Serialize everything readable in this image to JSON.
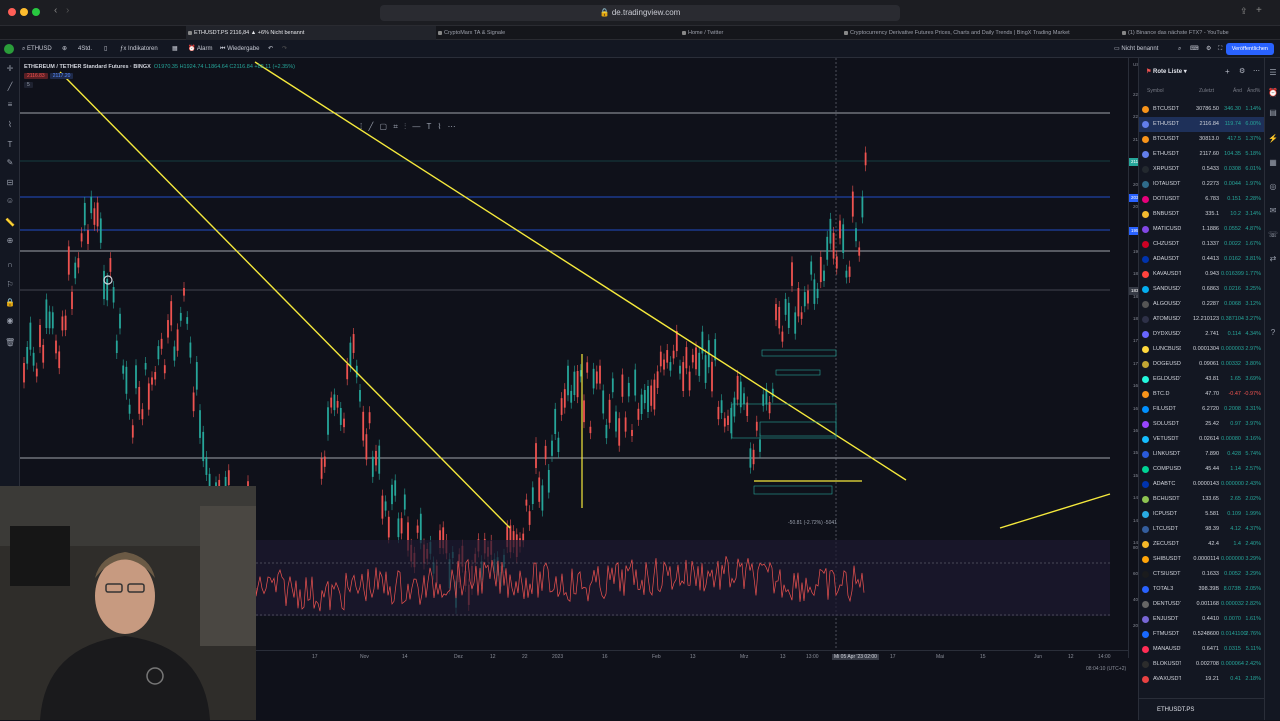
{
  "browser": {
    "url": "de.tradingview.com",
    "tabs": [
      {
        "label": "ETHUSDT.PS 2116,84 ▲ +6% Nicht benannt",
        "active": true
      },
      {
        "label": "CryptoMarx TA & Signale",
        "active": false
      },
      {
        "label": "Home / Twitter",
        "active": false
      },
      {
        "label": "Cryptocurrency Derivative Futures Prices, Charts and Daily Trends | BingX Trading Market",
        "active": false
      },
      {
        "label": "(1) Binance das nächste FTX? - YouTube",
        "active": false
      }
    ]
  },
  "toolbar": {
    "symbol": "ETHUSD",
    "interval": "4Std.",
    "indicators": "Indikatoren",
    "alarm": "Alarm",
    "replay": "Wiedergabe",
    "layout_name": "Nicht benannt",
    "layout_sub": "Speichern",
    "publish": "Veröffentlichen"
  },
  "legend": {
    "title": "ETHEREUM / TETHER Standard Futures · BINGX",
    "ohlc": "O1970.35 H1924.74 L1864.64 C2116.84 +82.11 (+2.35%)",
    "bid": "2116.83",
    "ask": "2117.20",
    "spread": "5"
  },
  "price_axis": {
    "currency": "USDT",
    "ticks": [
      "2250.00",
      "2200.00",
      "2150.00",
      "2100.00",
      "2060.00",
      "2010.00",
      "1960.00",
      "1920.00",
      "1880.00",
      "1850.00",
      "1810.00",
      "1770.00",
      "1730.00",
      "1690.00",
      "1650.00",
      "1610.00",
      "1570.00",
      "1530.00",
      "1490.00",
      "1450.00",
      "1410.00"
    ],
    "rsi_ticks": [
      "80.00",
      "60.00",
      "40.00",
      "20.00"
    ],
    "price_label": "ETHUSDT.PS",
    "price_value": "2116.84",
    "price_sub": "01:57:02",
    "level_a": "2031.89",
    "level_b": "1957.23",
    "crosshair_value": "1831.89"
  },
  "time_axis": {
    "ticks": [
      "17",
      "Nov",
      "14",
      "Dez",
      "12",
      "22",
      "2023",
      "16",
      "Feb",
      "13",
      "Mrz",
      "13",
      "13:00",
      "Mi 05 Apr '23  02:00",
      "17",
      "Mai",
      "15",
      "Jun",
      "12",
      "14:00"
    ],
    "timezone": "08:04:10 (UTC+2)",
    "scale": "auto"
  },
  "measure": {
    "label": "-50.81 (-2.72%) -5041"
  },
  "watchlist": {
    "title": "Rote Liste",
    "columns": {
      "symbol": "Symbol",
      "last": "Zuletzt",
      "chg": "Änd",
      "chg_pct": "Änd%"
    },
    "rows": [
      {
        "symbol": "BTCUSDT",
        "last": "30786.50",
        "chg": "346.30",
        "pct": "1.14%",
        "color": "#f7931a",
        "sel": false
      },
      {
        "symbol": "ETHUSDT",
        "last": "2116.84",
        "chg": "119.74",
        "pct": "6.00%",
        "color": "#627eea",
        "sel": true
      },
      {
        "symbol": "BTCUSDT",
        "last": "30813.0",
        "chg": "417.5",
        "pct": "1.37%",
        "color": "#f7931a",
        "sel": false
      },
      {
        "symbol": "ETHUSDT",
        "last": "2117.60",
        "chg": "104.35",
        "pct": "5.18%",
        "color": "#627eea",
        "sel": false
      },
      {
        "symbol": "XRPUSDT",
        "last": "0.5433",
        "chg": "0.0308",
        "pct": "6.01%",
        "color": "#23292f",
        "sel": false
      },
      {
        "symbol": "IOTAUSDT",
        "last": "0.2273",
        "chg": "0.0044",
        "pct": "1.97%",
        "color": "#2f6b8a",
        "sel": false
      },
      {
        "symbol": "DOTUSDT",
        "last": "6.783",
        "chg": "0.151",
        "pct": "2.28%",
        "color": "#e6007a",
        "sel": false
      },
      {
        "symbol": "BNBUSDT",
        "last": "335.1",
        "chg": "10.2",
        "pct": "3.14%",
        "color": "#f3ba2f",
        "sel": false
      },
      {
        "symbol": "MATICUSDT",
        "last": "1.1886",
        "chg": "0.0552",
        "pct": "4.87%",
        "color": "#8247e5",
        "sel": false
      },
      {
        "symbol": "CHZUSDT",
        "last": "0.1337",
        "chg": "0.0022",
        "pct": "1.67%",
        "color": "#cd0124",
        "sel": false
      },
      {
        "symbol": "ADAUSDT",
        "last": "0.4413",
        "chg": "0.0162",
        "pct": "3.81%",
        "color": "#0033ad",
        "sel": false
      },
      {
        "symbol": "KAVAUSDT",
        "last": "0.943",
        "chg": "0.016399",
        "pct": "1.77%",
        "color": "#ff433e",
        "sel": false
      },
      {
        "symbol": "SANDUSDT",
        "last": "0.6863",
        "chg": "0.0216",
        "pct": "3.25%",
        "color": "#04adef",
        "sel": false
      },
      {
        "symbol": "ALGOUSDT",
        "last": "0.2287",
        "chg": "0.0068",
        "pct": "3.12%",
        "color": "#555555",
        "sel": false
      },
      {
        "symbol": "ATOMUSDT",
        "last": "12.210123",
        "chg": "0.387104",
        "pct": "3.27%",
        "color": "#2e3148",
        "sel": false
      },
      {
        "symbol": "DYDXUSDT",
        "last": "2.741",
        "chg": "0.114",
        "pct": "4.34%",
        "color": "#6966ff",
        "sel": false
      },
      {
        "symbol": "LUNCBUSD",
        "last": "0.0001304",
        "chg": "0.000003",
        "pct": "2.97%",
        "color": "#ffd83d",
        "sel": false
      },
      {
        "symbol": "DOGEUSDT",
        "last": "0.09061",
        "chg": "0.00332",
        "pct": "3.80%",
        "color": "#c2a633",
        "sel": false
      },
      {
        "symbol": "EGLDUSDT",
        "last": "43.81",
        "chg": "1.65",
        "pct": "3.69%",
        "color": "#23f7dd",
        "sel": false
      },
      {
        "symbol": "BTC.D",
        "last": "47.70",
        "chg": "-0.47",
        "pct": "-0.97%",
        "color": "#f7931a",
        "sel": false
      },
      {
        "symbol": "FILUSDT",
        "last": "6.2720",
        "chg": "0.2008",
        "pct": "3.31%",
        "color": "#0090ff",
        "sel": false
      },
      {
        "symbol": "SOLUSDT",
        "last": "25.42",
        "chg": "0.97",
        "pct": "3.97%",
        "color": "#9945ff",
        "sel": false
      },
      {
        "symbol": "VETUSDT",
        "last": "0.02614",
        "chg": "0.00080",
        "pct": "3.16%",
        "color": "#15bdff",
        "sel": false
      },
      {
        "symbol": "LINKUSDT",
        "last": "7.890",
        "chg": "0.428",
        "pct": "5.74%",
        "color": "#2a5ada",
        "sel": false
      },
      {
        "symbol": "COMPUSDT",
        "last": "45.44",
        "chg": "1.14",
        "pct": "2.57%",
        "color": "#00d395",
        "sel": false
      },
      {
        "symbol": "ADABTC",
        "last": "0.0000143",
        "chg": "0.000000",
        "pct": "2.43%",
        "color": "#0033ad",
        "sel": false
      },
      {
        "symbol": "BCHUSDT",
        "last": "133.65",
        "chg": "2.65",
        "pct": "2.02%",
        "color": "#8dc351",
        "sel": false
      },
      {
        "symbol": "ICPUSDT",
        "last": "5.581",
        "chg": "0.109",
        "pct": "1.99%",
        "color": "#29abe2",
        "sel": false
      },
      {
        "symbol": "LTCUSDT",
        "last": "98.39",
        "chg": "4.12",
        "pct": "4.37%",
        "color": "#345d9d",
        "sel": false
      },
      {
        "symbol": "ZECUSDT",
        "last": "42.4",
        "chg": "1.4",
        "pct": "2.40%",
        "color": "#f4b728",
        "sel": false
      },
      {
        "symbol": "SHIBUSDT",
        "last": "0.0000114",
        "chg": "0.000000",
        "pct": "3.29%",
        "color": "#ffa409",
        "sel": false
      },
      {
        "symbol": "CTSIUSDT",
        "last": "0.1633",
        "chg": "0.0052",
        "pct": "3.29%",
        "color": "#1a1b1d",
        "sel": false
      },
      {
        "symbol": "TOTAL3",
        "last": "398.39B",
        "chg": "8.073B",
        "pct": "2.05%",
        "color": "#2962ff",
        "sel": false
      },
      {
        "symbol": "DENTUSDT",
        "last": "0.001168",
        "chg": "0.000032",
        "pct": "2.82%",
        "color": "#666666",
        "sel": false
      },
      {
        "symbol": "ENJUSDT",
        "last": "0.4410",
        "chg": "0.0070",
        "pct": "1.61%",
        "color": "#7866d5",
        "sel": false
      },
      {
        "symbol": "FTMUSDT",
        "last": "0.5248600",
        "chg": "0.0141100",
        "pct": "2.76%",
        "color": "#1969ff",
        "sel": false
      },
      {
        "symbol": "MANAUSDT",
        "last": "0.6471",
        "chg": "0.0315",
        "pct": "5.11%",
        "color": "#ff2d55",
        "sel": false
      },
      {
        "symbol": "BLOKUSDT",
        "last": "0.002708",
        "chg": "0.000064",
        "pct": "2.42%",
        "color": "#2c2c2c",
        "sel": false
      },
      {
        "symbol": "AVAXUSDT",
        "last": "19.21",
        "chg": "0.41",
        "pct": "2.18%",
        "color": "#e84142",
        "sel": false
      }
    ],
    "footer": "ETHUSDT.PS"
  }
}
